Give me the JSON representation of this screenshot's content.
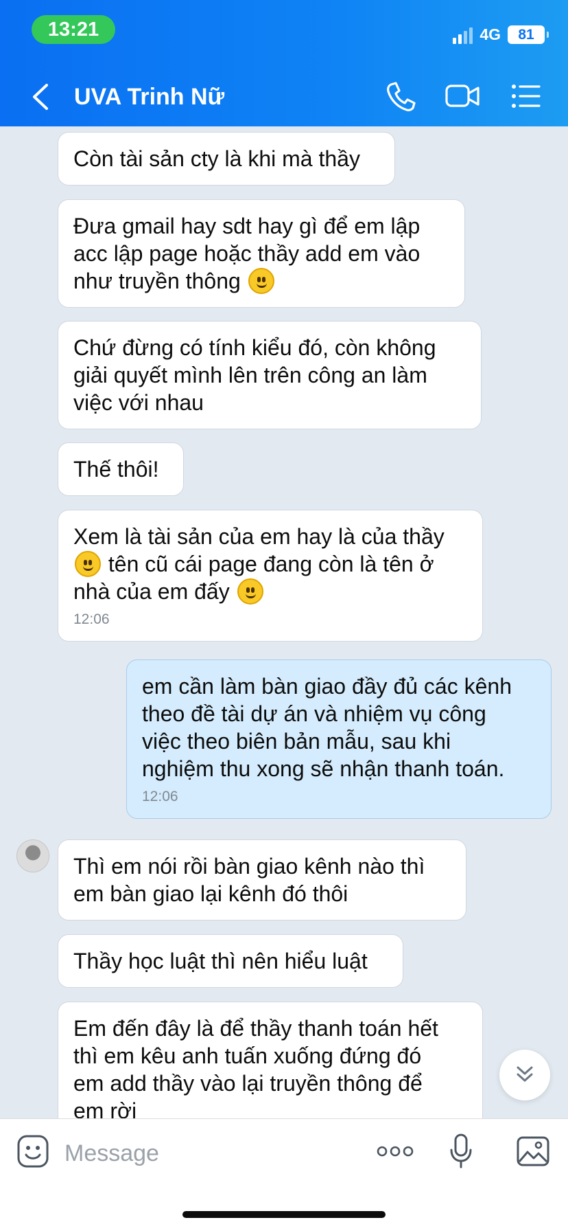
{
  "status": {
    "time": "13:21",
    "network": "4G",
    "battery": "81"
  },
  "header": {
    "title": "UVA Trinh Nữ"
  },
  "messages": [
    {
      "parts": [
        "Còn tài sản cty là khi mà thầy"
      ]
    },
    {
      "parts": [
        "Đưa gmail hay sdt hay gì để em lập",
        "acc lập page hoặc thầy add em vào",
        "như truyền thông"
      ]
    },
    {
      "parts": [
        "Chứ đừng có tính kiểu đó, còn không",
        "giải quyết mình lên trên công an làm",
        "việc với nhau"
      ]
    },
    {
      "parts": [
        "Thế thôi!"
      ]
    },
    {
      "parts": [
        "Xem là tài sản của em hay là của thầy",
        "tên cũ cái page đang còn là tên ở",
        "nhà của em đấy"
      ],
      "time": "12:06"
    },
    {
      "parts": [
        "em cần làm bàn giao đầy đủ các kênh",
        "theo đề tài dự án và nhiệm vụ công",
        "việc theo biên bản mẫu, sau khi",
        "nghiệm thu xong sẽ nhận thanh toán."
      ],
      "time": "12:06"
    },
    {
      "parts": [
        "Thì em nói rồi bàn giao kênh nào thì",
        "em bàn giao lại kênh đó thôi"
      ]
    },
    {
      "parts": [
        "Thầy học luật thì nên hiểu luật"
      ]
    },
    {
      "parts": [
        "Em đến đây là để thầy thanh toán hết",
        "thì em kêu anh tuấn xuống đứng đó",
        "em add thầy vào lại truyền thông để",
        "em rời"
      ]
    }
  ],
  "composer": {
    "placeholder": "Message"
  },
  "icons": {
    "back": "chevron-left-icon",
    "call": "phone-icon",
    "video": "video-camera-icon",
    "menu": "list-menu-icon",
    "sticker": "sticker-smiley-icon",
    "more": "more-dots-icon",
    "mic": "microphone-icon",
    "gallery": "image-gallery-icon",
    "scroll": "double-chevron-down-icon",
    "emoji": "smiley-emoji-icon"
  },
  "colors": {
    "header": "#0f84f5",
    "time_pill": "#34c759",
    "outgoing_bubble": "#d4ecfd",
    "incoming_bubble": "#ffffff",
    "background": "#e2e9f1"
  }
}
